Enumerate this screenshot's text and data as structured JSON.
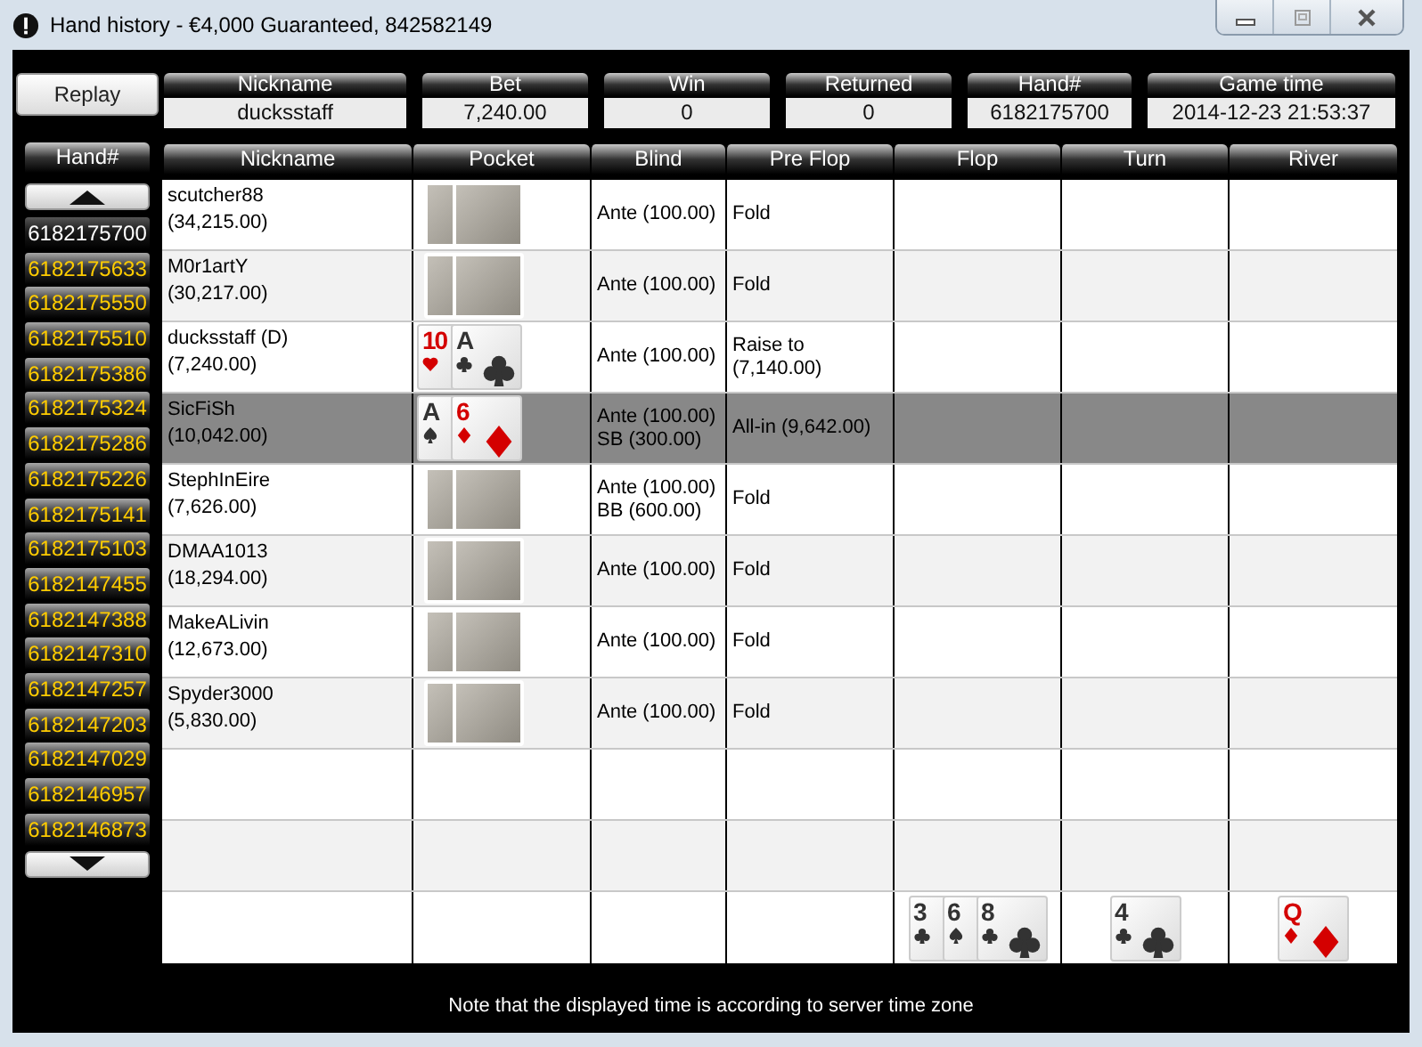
{
  "window": {
    "title": "Hand history - €4,000 Guaranteed, 842582149"
  },
  "replay_button": "Replay",
  "summary": [
    {
      "label": "Nickname",
      "value": "ducksstaff"
    },
    {
      "label": "Bet",
      "value": "7,240.00"
    },
    {
      "label": "Win",
      "value": "0"
    },
    {
      "label": "Returned",
      "value": "0"
    },
    {
      "label": "Hand#",
      "value": "6182175700"
    },
    {
      "label": "Game time",
      "value": "2014-12-23 21:53:37"
    }
  ],
  "hand_list": {
    "header": "Hand#",
    "items": [
      {
        "number": "6182175700",
        "selected": true
      },
      {
        "number": "6182175633",
        "selected": false
      },
      {
        "number": "6182175550",
        "selected": false
      },
      {
        "number": "6182175510",
        "selected": false
      },
      {
        "number": "6182175386",
        "selected": false
      },
      {
        "number": "6182175324",
        "selected": false
      },
      {
        "number": "6182175286",
        "selected": false
      },
      {
        "number": "6182175226",
        "selected": false
      },
      {
        "number": "6182175141",
        "selected": false
      },
      {
        "number": "6182175103",
        "selected": false
      },
      {
        "number": "6182147455",
        "selected": false
      },
      {
        "number": "6182147388",
        "selected": false
      },
      {
        "number": "6182147310",
        "selected": false
      },
      {
        "number": "6182147257",
        "selected": false
      },
      {
        "number": "6182147203",
        "selected": false
      },
      {
        "number": "6182147029",
        "selected": false
      },
      {
        "number": "6182146957",
        "selected": false
      },
      {
        "number": "6182146873",
        "selected": false
      }
    ]
  },
  "table": {
    "columns": [
      "Nickname",
      "Pocket",
      "Blind",
      "Pre Flop",
      "Flop",
      "Turn",
      "River"
    ],
    "rows": [
      {
        "nickname": "scutcher88",
        "stack": "(34,215.00)",
        "selected": false,
        "pocket": [
          {
            "kind": "back"
          },
          {
            "kind": "back"
          }
        ],
        "blind": [
          "Ante (100.00)"
        ],
        "preflop": "Fold"
      },
      {
        "nickname": "M0r1artY",
        "stack": "(30,217.00)",
        "selected": false,
        "pocket": [
          {
            "kind": "back"
          },
          {
            "kind": "back"
          }
        ],
        "blind": [
          "Ante (100.00)"
        ],
        "preflop": "Fold"
      },
      {
        "nickname": "ducksstaff (D)",
        "stack": "(7,240.00)",
        "selected": false,
        "pocket": [
          {
            "kind": "hearts",
            "rank": "10"
          },
          {
            "kind": "clubs",
            "rank": "A"
          }
        ],
        "blind": [
          "Ante (100.00)"
        ],
        "preflop": "Raise to (7,140.00)"
      },
      {
        "nickname": "SicFiSh",
        "stack": "(10,042.00)",
        "selected": true,
        "pocket": [
          {
            "kind": "spades",
            "rank": "A"
          },
          {
            "kind": "diamonds",
            "rank": "6"
          }
        ],
        "blind": [
          "Ante (100.00)",
          "SB (300.00)"
        ],
        "preflop": "All-in (9,642.00)"
      },
      {
        "nickname": "StephInEire",
        "stack": "(7,626.00)",
        "selected": false,
        "pocket": [
          {
            "kind": "back"
          },
          {
            "kind": "back"
          }
        ],
        "blind": [
          "Ante (100.00)",
          "BB (600.00)"
        ],
        "preflop": "Fold"
      },
      {
        "nickname": "DMAA1013",
        "stack": "(18,294.00)",
        "selected": false,
        "pocket": [
          {
            "kind": "back"
          },
          {
            "kind": "back"
          }
        ],
        "blind": [
          "Ante (100.00)"
        ],
        "preflop": "Fold"
      },
      {
        "nickname": "MakeALivin",
        "stack": "(12,673.00)",
        "selected": false,
        "pocket": [
          {
            "kind": "back"
          },
          {
            "kind": "back"
          }
        ],
        "blind": [
          "Ante (100.00)"
        ],
        "preflop": "Fold"
      },
      {
        "nickname": "Spyder3000",
        "stack": "(5,830.00)",
        "selected": false,
        "pocket": [
          {
            "kind": "back"
          },
          {
            "kind": "back"
          }
        ],
        "blind": [
          "Ante (100.00)"
        ],
        "preflop": "Fold"
      }
    ],
    "board": {
      "flop": [
        {
          "kind": "clubs",
          "rank": "3"
        },
        {
          "kind": "spades",
          "rank": "6"
        },
        {
          "kind": "clubs",
          "rank": "8"
        }
      ],
      "turn": [
        {
          "kind": "clubs",
          "rank": "4"
        }
      ],
      "river": [
        {
          "kind": "diamonds",
          "rank": "Q"
        }
      ]
    }
  },
  "note": "Note that the displayed time is according to server time zone"
}
